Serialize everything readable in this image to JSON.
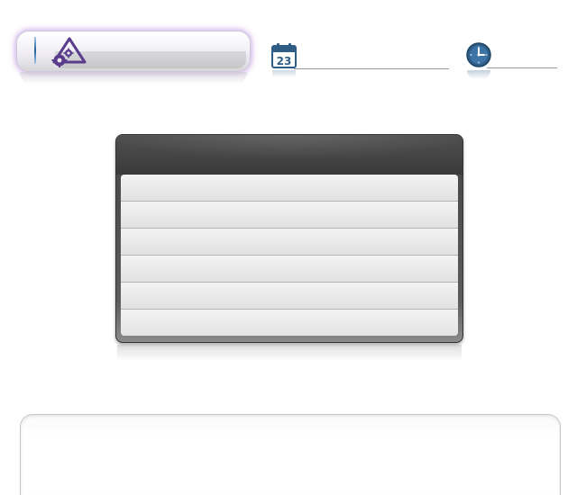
{
  "toolbar": {
    "alert_field": {
      "value": "",
      "icon": "warning-settings-icon"
    },
    "date_field": {
      "value": "",
      "icon": "calendar-icon",
      "calendar_day": "23"
    },
    "time_field": {
      "value": "",
      "icon": "clock-icon"
    }
  },
  "panel": {
    "title": "",
    "rows": [
      "",
      "",
      "",
      "",
      "",
      ""
    ]
  },
  "bottom_box": {
    "content": ""
  },
  "colors": {
    "accent_glow": "#b082dc",
    "icon_purple": "#5a3c8c",
    "icon_blue": "#2f5d86",
    "panel_dark": "#3a3a3a"
  }
}
